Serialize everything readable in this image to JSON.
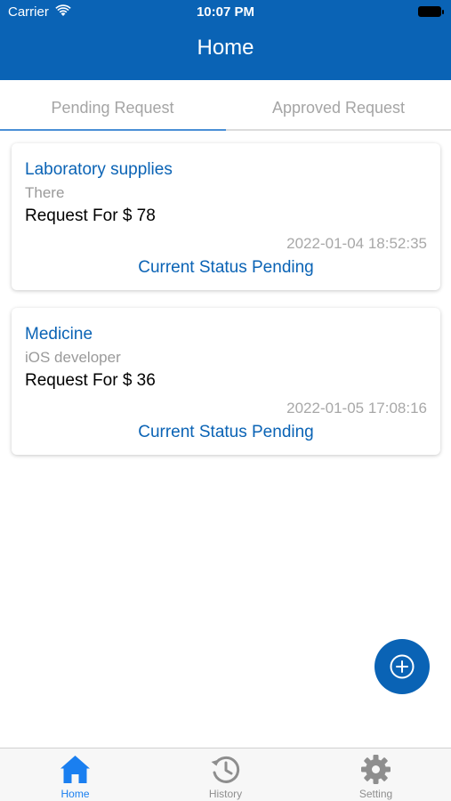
{
  "status_bar": {
    "carrier": "Carrier",
    "time": "10:07 PM"
  },
  "header": {
    "title": "Home"
  },
  "tabs": [
    {
      "label": "Pending Request",
      "selected": true
    },
    {
      "label": "Approved Request",
      "selected": false
    }
  ],
  "requests": [
    {
      "title": "Laboratory supplies",
      "subtitle": "There",
      "amount": "Request For $ 78",
      "date": "2022-01-04 18:52:35",
      "status": "Current Status Pending"
    },
    {
      "title": "Medicine",
      "subtitle": "iOS developer",
      "amount": "Request For $ 36",
      "date": "2022-01-05 17:08:16",
      "status": "Current Status Pending"
    }
  ],
  "fab": {
    "icon": "plus-circle-icon"
  },
  "tabbar": {
    "items": [
      {
        "label": "Home",
        "icon": "home-icon",
        "active": true
      },
      {
        "label": "History",
        "icon": "history-icon",
        "active": false
      },
      {
        "label": "Setting",
        "icon": "gear-icon",
        "active": false
      }
    ]
  },
  "colors": {
    "primary": "#0a63b5",
    "tab_active": "#1a7ff0",
    "muted_text": "#a5a5a5",
    "indicator": "#4a8fd6"
  }
}
